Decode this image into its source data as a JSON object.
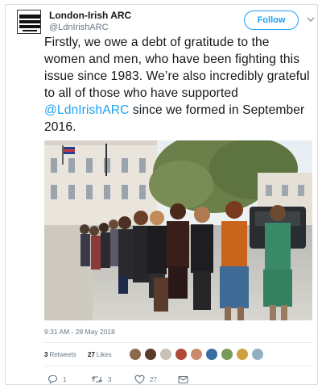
{
  "account": {
    "name": "London-Irish ARC",
    "handle": "@LdnIrishARC",
    "follow_label": "Follow"
  },
  "tweet": {
    "text_before": "Firstly, we owe a debt of gratitude to the women and men, who have been fighting this issue since 1983. We’re also incredibly grateful to all of those who have supported ",
    "mention": "@LdnIrishARC",
    "text_after": " since we formed in September 2016.",
    "timestamp": "9:31 AM - 28 May 2018"
  },
  "stats": {
    "retweets_count": "3",
    "retweets_label": "Retweets",
    "likes_count": "27",
    "likes_label": "Likes"
  },
  "actions": {
    "reply_count": "1",
    "retweet_count": "3",
    "like_count": "27"
  },
  "icons": {
    "reply": "reply-icon",
    "retweet": "retweet-icon",
    "like": "heart-icon",
    "message": "envelope-icon",
    "more": "chevron-down-icon"
  },
  "colors": {
    "accent": "#1da1f2",
    "text": "#14171a",
    "secondary": "#657786",
    "border": "#e6ecf0"
  },
  "likers": [
    {
      "color": "#8a6a4a"
    },
    {
      "color": "#5a3a2a"
    },
    {
      "color": "#c9c1b8"
    },
    {
      "color": "#b04a3a"
    },
    {
      "color": "#c98a6a"
    },
    {
      "color": "#3a6ea0"
    },
    {
      "color": "#7a9a5a"
    },
    {
      "color": "#d0a040"
    },
    {
      "color": "#90b0c0"
    }
  ]
}
